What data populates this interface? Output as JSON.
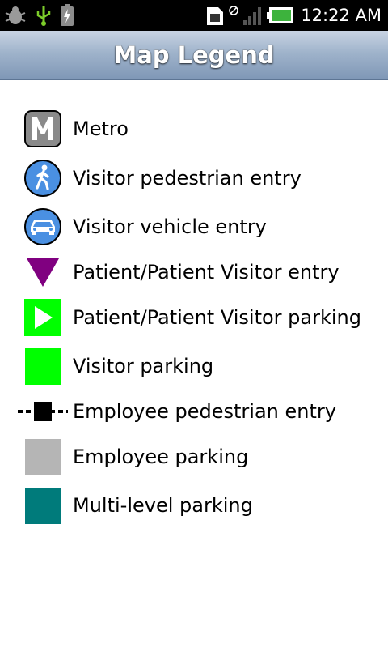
{
  "status_bar": {
    "time": "12:22 AM",
    "left_icons": [
      "bug-icon",
      "usb-icon",
      "battery-charging-icon"
    ],
    "right_icons": [
      "sim-icon",
      "no-signal-icon",
      "signal-bars-icon",
      "battery-icon"
    ]
  },
  "header": {
    "title": "Map Legend"
  },
  "legend": {
    "items": [
      {
        "label": "Metro",
        "icon": "metro-icon"
      },
      {
        "label": "Visitor pedestrian entry",
        "icon": "pedestrian-icon",
        "color": "#4a90e2"
      },
      {
        "label": "Visitor vehicle entry",
        "icon": "car-icon",
        "color": "#4a90e2"
      },
      {
        "label": "Patient/Patient Visitor entry",
        "icon": "triangle-down-icon",
        "color": "#800080"
      },
      {
        "label": "Patient/Patient Visitor parking",
        "icon": "play-square-icon",
        "color": "#00ff00"
      },
      {
        "label": "Visitor parking",
        "icon": "square-icon",
        "color": "#00ff00"
      },
      {
        "label": "Employee pedestrian entry",
        "icon": "dashed-line-square-icon",
        "color": "#000000"
      },
      {
        "label": "Employee parking",
        "icon": "square-icon",
        "color": "#b5b5b5"
      },
      {
        "label": "Multi-level parking",
        "icon": "square-icon",
        "color": "#007b7b"
      }
    ]
  }
}
